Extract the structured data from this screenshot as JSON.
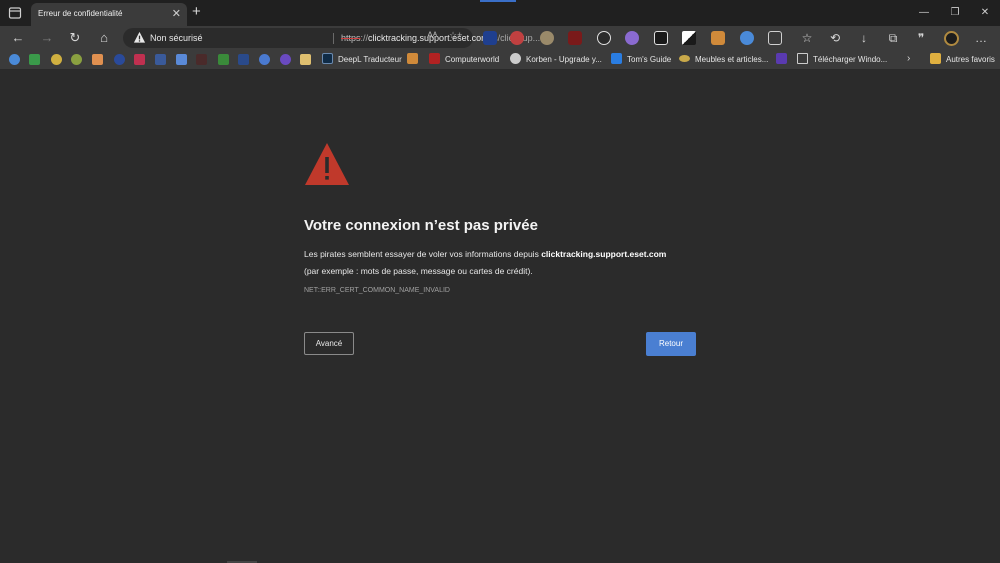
{
  "tab": {
    "title": "Erreur de confidentialité",
    "close": "✕"
  },
  "new_tab_glyph": "+",
  "window_controls": {
    "minimize": "—",
    "restore": "❐",
    "close": "✕"
  },
  "nav": {
    "back": "←",
    "forward": "→",
    "reload": "↻",
    "home": "⌂"
  },
  "address": {
    "security_label": "Non sécurisé",
    "scheme": "https",
    "separator": "://",
    "host": "clicktracking.support.eset.com",
    "path": "/ls/click?up..."
  },
  "omnibox_actions": {
    "read_aloud": "Aᴬ",
    "favorite": "☆+"
  },
  "extensions": [
    "bitwarden-icon",
    "ublock-origin-icon",
    "sun-icon",
    "ublock-icon",
    "chat-icon",
    "purple-circle-icon",
    "square-icon",
    "contrast-icon",
    "cup-icon",
    "translate-icon",
    "puzzle-icon"
  ],
  "toolbar_right": {
    "favorites": "☆",
    "history": "⟲",
    "downloads": "↓",
    "collections": "⧉",
    "quotes": "❞",
    "more": "…"
  },
  "favorites_bar": {
    "items": [
      {
        "label": "DeepL Traducteur",
        "color": "#0f2b46"
      },
      {
        "label": "Computerworld",
        "color": "#b22222"
      },
      {
        "label": "Korben - Upgrade y...",
        "color": "#cccccc"
      },
      {
        "label": "Tom's Guide",
        "color": "#2a7de1"
      },
      {
        "label": "Meubles et articles...",
        "color": "#c9a94a"
      },
      {
        "label": "Télécharger Windo...",
        "color": "#cccccc"
      }
    ],
    "other_favorites": "Autres favoris",
    "overflow": "›"
  },
  "page": {
    "heading": "Votre connexion n’est pas privée",
    "desc_prefix": "Les pirates semblent essayer de voler vos informations depuis ",
    "desc_host": "clicktracking.support.eset.com",
    "desc_suffix": "(par exemple : mots de passe, message ou cartes de crédit).",
    "error_code": "NET::ERR_CERT_COMMON_NAME_INVALID",
    "advanced_button": "Avancé",
    "back_button": "Retour"
  },
  "colors": {
    "warning_red": "#c0392b",
    "primary_blue": "#4a7fd2",
    "background": "#2b2b2b"
  }
}
